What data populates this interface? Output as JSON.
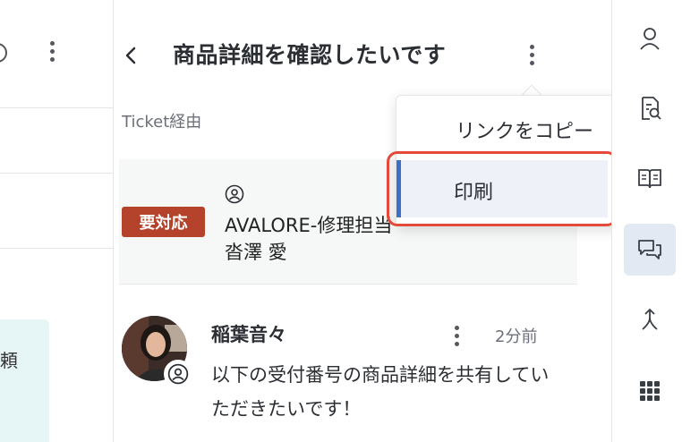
{
  "left_pane": {
    "card_text": "頼"
  },
  "header": {
    "title": "商品詳細を確認したいです"
  },
  "ticket": {
    "via_label": "Ticket経由",
    "status_badge": "要対応",
    "assignee_line1": "AVALORE-修理担当",
    "assignee_line2": "沓澤 愛"
  },
  "message": {
    "sender": "稲葉音々",
    "time": "2分前",
    "text": "以下の受付番号の商品詳細を共有していただきたいです！"
  },
  "menu": {
    "copy_link": "リンクをコピー",
    "print": "印刷"
  },
  "colors": {
    "badge": "#b5432c",
    "menu_selected_bar": "#3d6fc4",
    "highlight": "#e5493a",
    "active_nav": "#e3e9f2"
  },
  "right_bar": {
    "icons": [
      "person-icon",
      "document-search-icon",
      "book-icon",
      "chat-icon",
      "merge-icon",
      "apps-grid-icon"
    ],
    "active": "chat-icon"
  }
}
